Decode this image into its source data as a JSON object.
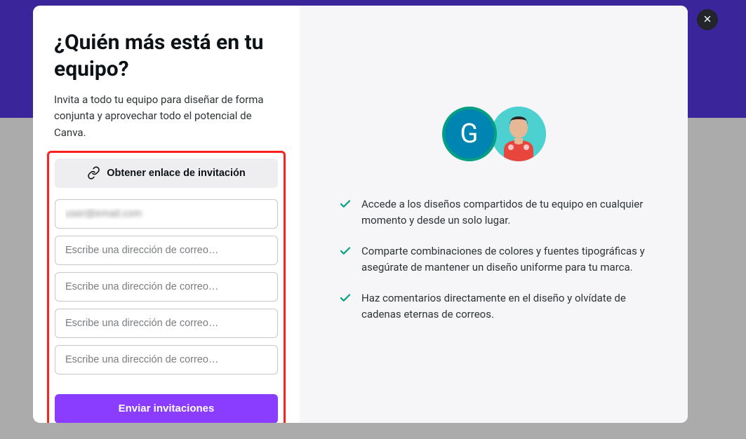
{
  "modal": {
    "title": "¿Quién más está en tu equipo?",
    "subtitle": "Invita a todo tu equipo para diseñar de forma conjunta y aprovechar todo el potencial de Canva.",
    "getLinkLabel": "Obtener enlace de invitación",
    "emailPlaceholder": "Escribe una dirección de correo…",
    "emailValue1": "user@email.com",
    "sendLabel": "Enviar invitaciones",
    "avatarLetter": "G"
  },
  "benefits": [
    "Accede a los diseños compartidos de tu equipo en cualquier momento y desde un solo lugar.",
    "Comparte combinaciones de colores y fuentes tipográficas y asegúrate de mantener un diseño uniforme para tu marca.",
    "Haz comentarios directamente en el diseño y olvídate de cadenas eternas de correos."
  ],
  "colors": {
    "accent": "#8b3dff",
    "highlight": "#ff2020",
    "check": "#04a081"
  }
}
